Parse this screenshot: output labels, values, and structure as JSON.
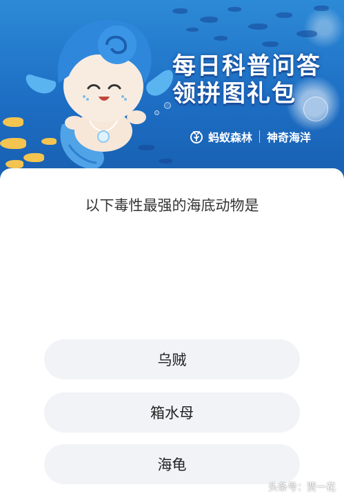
{
  "banner": {
    "title_line1": "每日科普问答",
    "title_line2": "领拼图礼包",
    "brand_left": "蚂蚁森林",
    "brand_right": "神奇海洋"
  },
  "quiz": {
    "question": "以下毒性最强的海底动物是",
    "options": [
      {
        "label": "乌贼"
      },
      {
        "label": "箱水母"
      },
      {
        "label": "海龟"
      }
    ]
  },
  "watermark": "头条号：贾一花",
  "colors": {
    "banner_blue": "#1d6ec4",
    "card_bg": "#ffffff",
    "option_bg": "#f1f3f6",
    "text_dark": "#222222"
  },
  "icons": {
    "brand_logo": "ant-forest-logo-icon",
    "mascot": "sea-mascot-illustration"
  }
}
